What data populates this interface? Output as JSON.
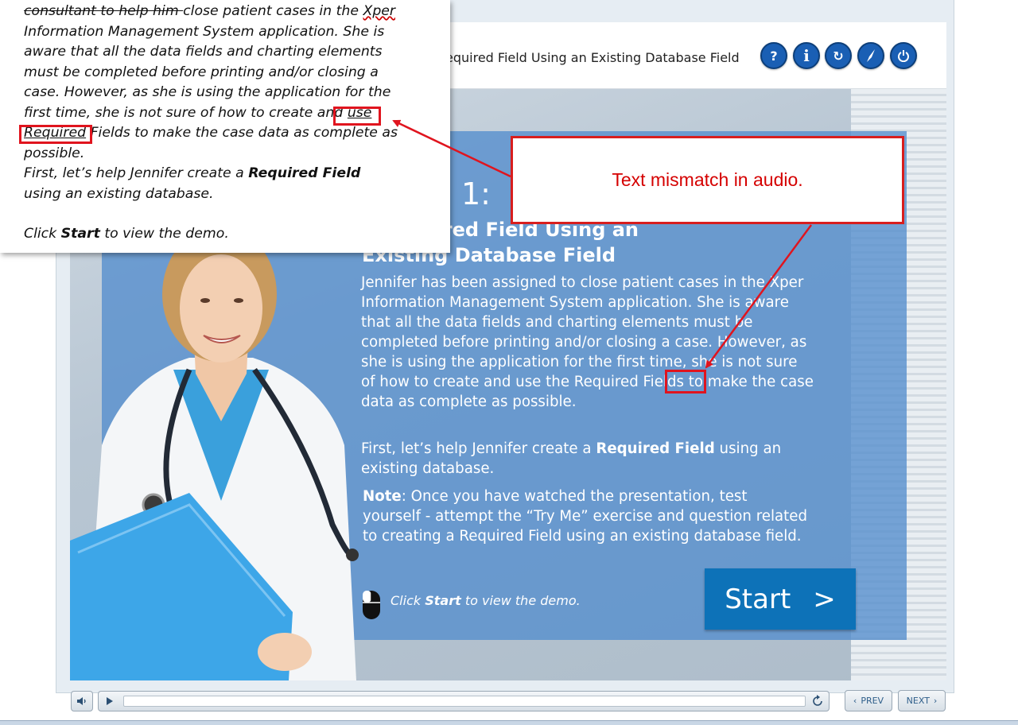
{
  "header": {
    "title": "equired Field Using an Existing Database Field",
    "buttons": [
      {
        "name": "help",
        "glyph": "?"
      },
      {
        "name": "info",
        "glyph": "i"
      },
      {
        "name": "refresh",
        "glyph": "↻"
      },
      {
        "name": "compass",
        "glyph": "⟋"
      },
      {
        "name": "power",
        "glyph": "⏻"
      }
    ]
  },
  "panel": {
    "number": "1:",
    "heading_line1": "a Required Field Using an",
    "heading_line2": "Existing Database Field",
    "body_pre": "Jennifer has been assigned to close patient cases in the Xper Information Management System application. She is aware that all the data fields and charting elements must be completed before printing and/or closing a case. However, as she is using the application for the first time, she is not sure of how to create and use ",
    "body_highlight": "the",
    "body_post": " Required Fields to make the case data as complete as possible.",
    "first_pre": "First, let’s help Jennifer create a ",
    "first_bold": "Required Field",
    "first_post": " using an existing database.",
    "note_label": "Note",
    "note_text": ": Once you have watched the presentation, test yourself - attempt the “Try Me” exercise and question related to creating a Required Field using an existing database field.",
    "click_pre": "Click ",
    "click_bold": "Start",
    "click_post": " to view the demo.",
    "start_label": "Start",
    "start_arrow": ">"
  },
  "transcript": {
    "struck": "consultant to help him ",
    "line1": "close patient cases in the ",
    "xper": "Xper",
    "body": " Information Management System application. She is aware that all the data fields and charting elements must be completed before printing and/or closing a case. However,  as she is using the application for the first time, she is not sure of how to create and ",
    "use": "use",
    "space": " ",
    "required": "Required",
    "after": " Fields to make the case data as complete as possible.",
    "first_pre": "First, let’s help Jennifer create a ",
    "first_bold": "Required Field",
    "first_post": " using an existing database.",
    "click_pre": "Click ",
    "click_bold": "Start",
    "click_post": " to view the demo."
  },
  "callout": {
    "text": "Text mismatch in audio."
  },
  "controls": {
    "prev_label": "PREV",
    "next_label": "NEXT",
    "progress": 0
  },
  "colors": {
    "accent": "#1a5fb4",
    "panel": "#568fcd",
    "start": "#0d72b8",
    "annotation_red": "#e0141e"
  }
}
